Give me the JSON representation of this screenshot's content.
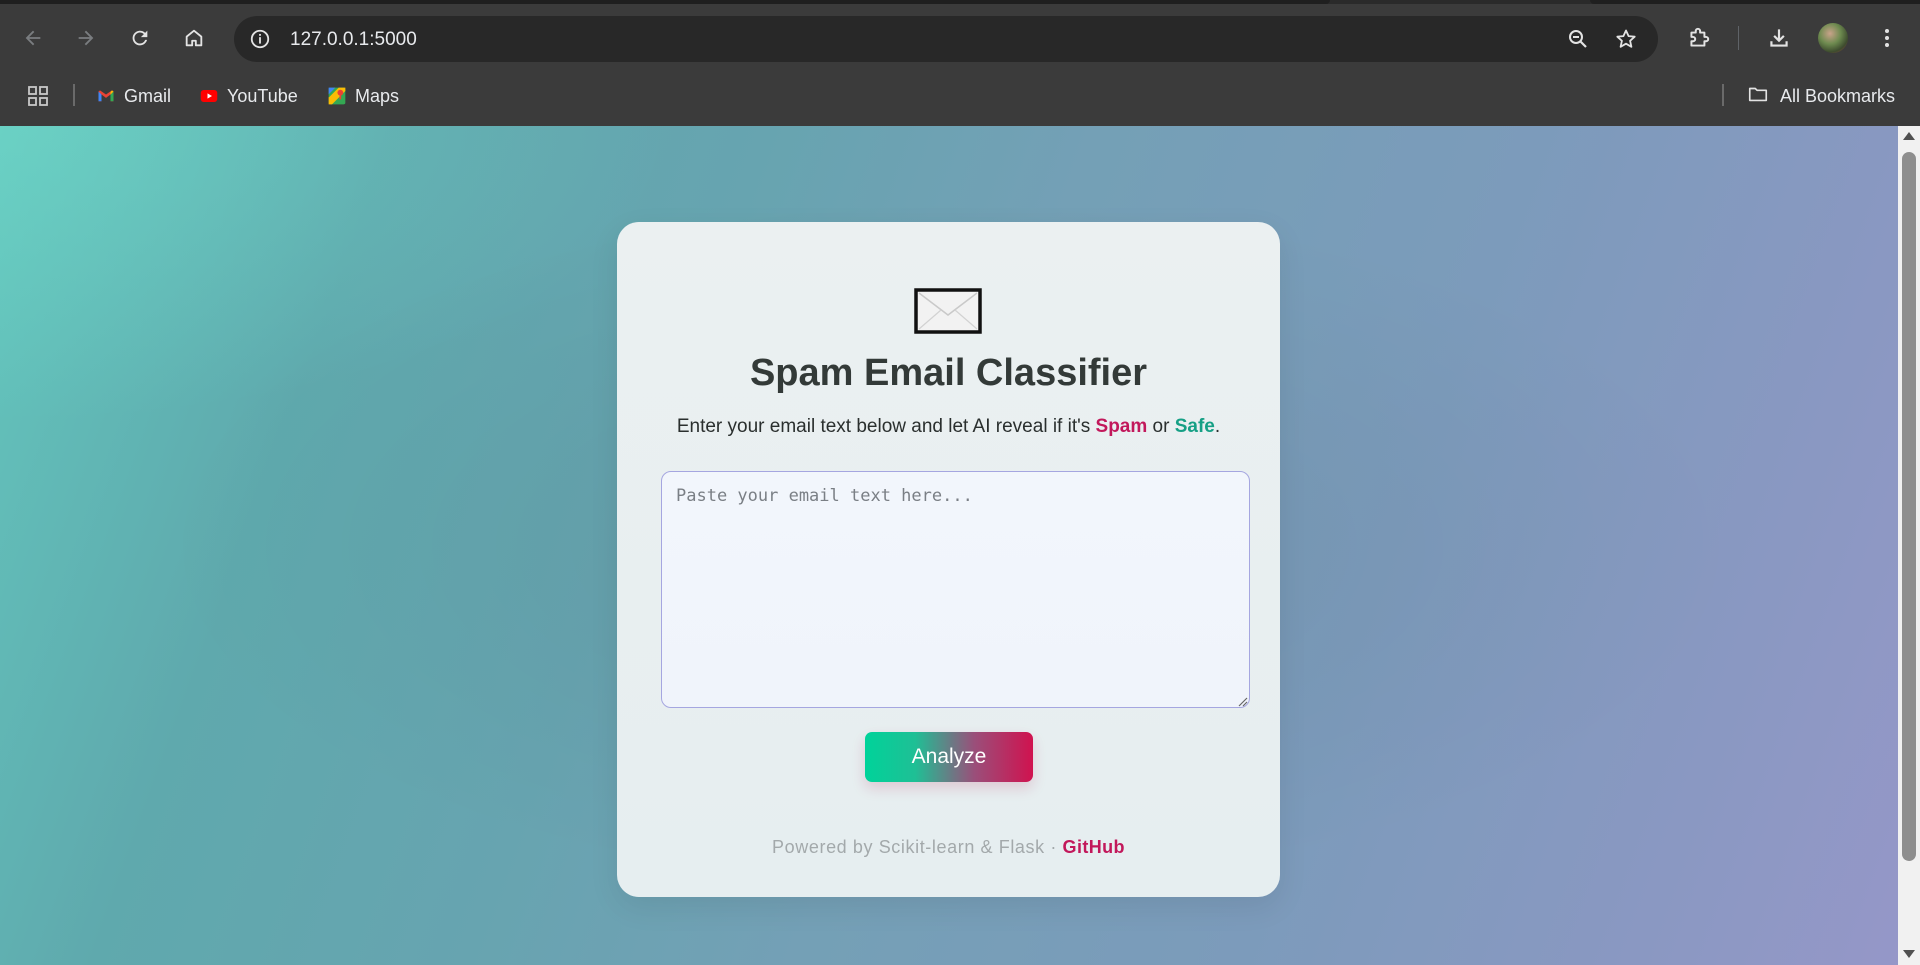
{
  "browser": {
    "url": "127.0.0.1:5000",
    "bookmarks": [
      {
        "label": "Gmail",
        "icon": "gmail-icon"
      },
      {
        "label": "YouTube",
        "icon": "youtube-icon"
      },
      {
        "label": "Maps",
        "icon": "maps-icon"
      }
    ],
    "all_bookmarks_label": "All Bookmarks"
  },
  "app": {
    "icon": "envelope-icon",
    "title": "Spam Email Classifier",
    "subtitle_prefix": "Enter your email text below and let AI reveal if it's ",
    "spam_word": "Spam",
    "subtitle_or": " or ",
    "safe_word": "Safe",
    "subtitle_suffix": ".",
    "input_placeholder": "Paste your email text here...",
    "input_value": "",
    "analyze_label": "Analyze",
    "footer_text": "Powered by Scikit-learn & Flask · ",
    "github_label": "GitHub"
  },
  "colors": {
    "spam": "#c2185b",
    "safe": "#16a085",
    "button_start": "#00d39a",
    "button_end": "#d0124f"
  }
}
